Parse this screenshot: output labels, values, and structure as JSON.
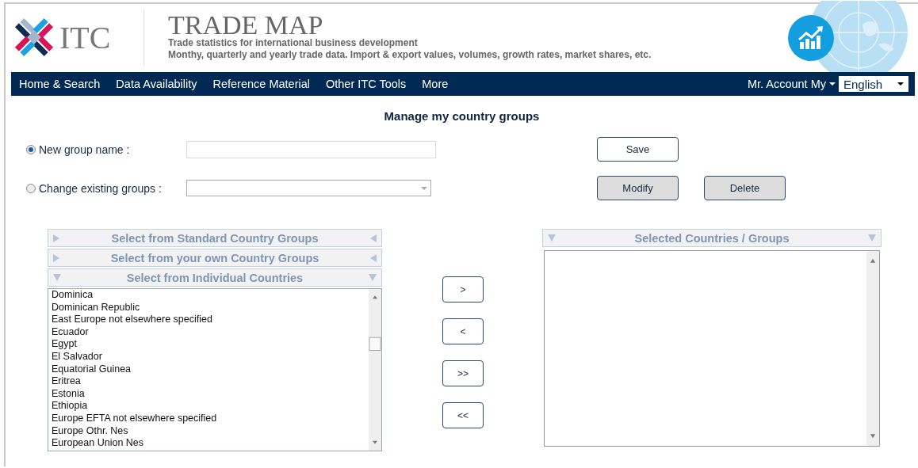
{
  "header": {
    "logo_text": "ITC",
    "title": "TRADE MAP",
    "subtitle": "Trade statistics for international business development",
    "description": "Monthy, quarterly and yearly trade data. Import & export values, volumes, growth rates, market shares, etc."
  },
  "nav": {
    "items": [
      "Home & Search",
      "Data Availability",
      "Reference Material",
      "Other ITC Tools",
      "More"
    ],
    "account": "Mr. Account My",
    "language": "English"
  },
  "page_title": "Manage my country groups",
  "options": [
    {
      "label": "New group name :",
      "selected": true,
      "kind": "text",
      "buttons": [
        {
          "label": "Save",
          "kind": "primary"
        }
      ]
    },
    {
      "label": "Change existing groups :",
      "selected": false,
      "kind": "dropdown",
      "buttons": [
        {
          "label": "Modify",
          "kind": "secondary"
        },
        {
          "label": "Delete",
          "kind": "secondary"
        }
      ]
    }
  ],
  "sections": [
    {
      "title": "Select from Standard Country Groups",
      "expanded": false
    },
    {
      "title": "Select from your own Country Groups",
      "expanded": false
    },
    {
      "title": "Select from Individual Countries",
      "expanded": true
    }
  ],
  "countries": [
    "Dominica",
    "Dominican Republic",
    "East Europe not elsewhere specified",
    "Ecuador",
    "Egypt",
    "El Salvador",
    "Equatorial Guinea",
    "Eritrea",
    "Estonia",
    "Ethiopia",
    "Europe EFTA not elsewhere specified",
    "Europe Othr. Nes",
    "European Union Nes"
  ],
  "transfer_buttons": [
    ">",
    "<",
    ">>",
    "<<"
  ],
  "selected_panel": {
    "title": "Selected Countries / Groups",
    "expanded": true
  }
}
